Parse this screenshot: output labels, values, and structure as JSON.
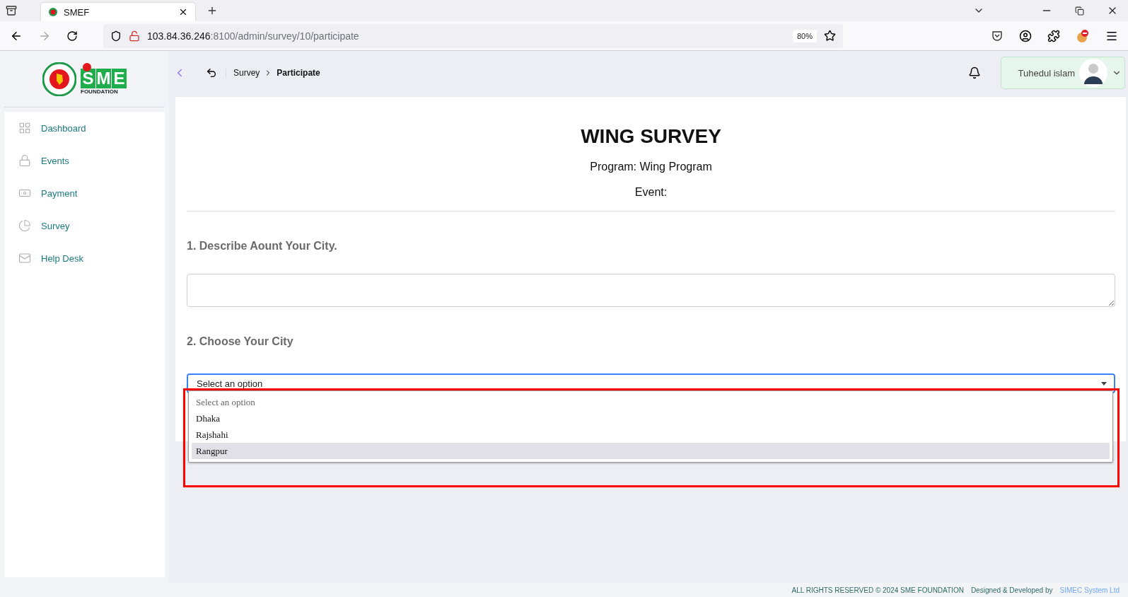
{
  "browser": {
    "tab": {
      "title": "SMEF"
    },
    "url": {
      "host": "103.84.36.246",
      "path": ":8100/admin/survey/10/participate"
    },
    "zoom": "80%"
  },
  "logo": {
    "letters": [
      "S",
      "M",
      "E"
    ],
    "subtext": "FOUNDATION"
  },
  "sidebar": {
    "items": [
      {
        "label": "Dashboard"
      },
      {
        "label": "Events"
      },
      {
        "label": "Payment"
      },
      {
        "label": "Survey"
      },
      {
        "label": "Help Desk"
      }
    ]
  },
  "breadcrumb": [
    "Survey",
    "Participate"
  ],
  "user": {
    "name": "Tuhedul islam"
  },
  "survey": {
    "title": "WING SURVEY",
    "program": "Program: Wing Program",
    "event": "Event:",
    "questions": [
      {
        "kind": "textarea",
        "label": "1. Describe Aount Your City."
      },
      {
        "kind": "select",
        "label": "2. Choose Your City",
        "value": "Select an option",
        "expanded": true,
        "options": [
          {
            "label": "Select an option",
            "selected": true,
            "highlighted": false
          },
          {
            "label": "Dhaka",
            "selected": false,
            "highlighted": false
          },
          {
            "label": "Rajshahi",
            "selected": false,
            "highlighted": false
          },
          {
            "label": "Rangpur",
            "selected": false,
            "highlighted": true
          }
        ]
      }
    ]
  },
  "footer": {
    "rights": "ALL RIGHTS RESERVED © 2024 SME FOUNDATION",
    "credit": "Designed & Developed by",
    "link": "SIMEC System Ltd"
  }
}
